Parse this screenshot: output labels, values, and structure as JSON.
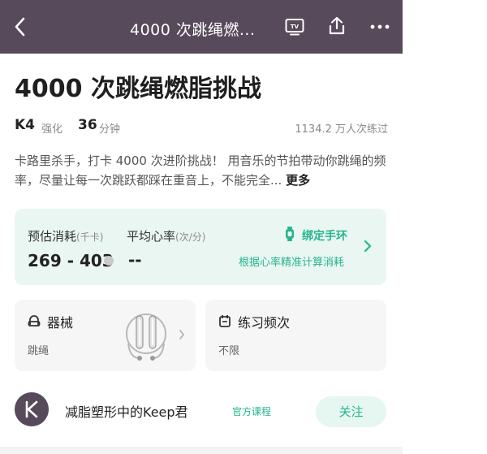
{
  "topbar": {
    "title": "4000 次跳绳燃...",
    "back_icon": "chevron-left-icon",
    "tv_icon": "tv-icon",
    "share_icon": "share-icon",
    "more_icon": "more-icon",
    "background": "#574a5b"
  },
  "course": {
    "title": "4000 次跳绳燃脂挑战",
    "level": "K4",
    "level_label": "强化",
    "duration": "36",
    "duration_unit": "分钟",
    "participants": "1134.2 万人次练过",
    "description": "卡路里杀手，打卡 4000 次进阶挑战！ 用音乐的节拍带动你跳绳的频率，尽量让每一次跳跃都踩在重音上，不能完全...",
    "more_label": "更多"
  },
  "stats": {
    "calories_label": "预估消耗",
    "calories_unit": "(千卡)",
    "calories_value": "269 - 403",
    "heart_label": "平均心率",
    "heart_unit": "(次/分)",
    "heart_value": "--",
    "band_label": "绑定手环",
    "band_sub": "根据心率精准计算消耗",
    "accent": "#26b58e"
  },
  "equipment": {
    "title": "器械",
    "value": "跳绳"
  },
  "frequency": {
    "title": "练习频次",
    "value": "不限"
  },
  "author": {
    "name": "减脂塑形中的Keep君",
    "tag": "官方课程",
    "follow_label": "关注"
  }
}
